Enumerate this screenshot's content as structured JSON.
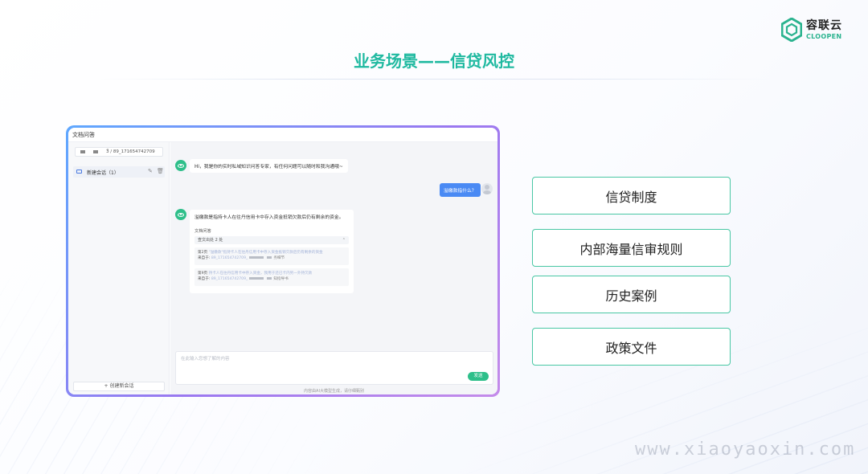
{
  "logo": {
    "name_cn": "容联云",
    "name_en": "CLOOPEN"
  },
  "title": "业务场景——信贷风控",
  "app": {
    "tab_label": "文档问答",
    "sidebar": {
      "kb_select_value": "Ӟ / 89_171654742709",
      "session_label": "新建会话（1）",
      "new_session_label": "+ 创建新会话"
    },
    "chat": {
      "greeting": "Hi，我是你的实时私域知识问答专家，有任何问题可以随时和我沟通哦~",
      "user_question": "溢缴款指什么？",
      "answer": "溢缴款是指持卡人在往丹信用卡中存入资金抵销欠款后仍有剩余的资金。",
      "doc_label": "文档问答",
      "source_header": "查文出处 2 处",
      "sources": [
        {
          "line1_prefix": "第2页",
          "line1_text": "\"溢缴款\"指持卡人在往丹信用卡中存入资金抵销欠款后仍有剩余的资金",
          "line2_prefix": "来自于:",
          "line2_text": "89_171654742709_",
          "line2_suffix": "务细节"
        },
        {
          "line1_prefix": "第9页",
          "line1_text": "持卡人在往丹信用卡中存入资金，我用于还已卡内另一外持欠款",
          "line2_prefix": "来自于:",
          "line2_text": "89_171654742709_",
          "line2_suffix": "知指导书"
        }
      ],
      "input_placeholder": "在此输入您想了解的内容",
      "send_label": "发送",
      "disclaimer": "内容由AI大模型生成，请仔细甄别"
    }
  },
  "features": [
    "信贷制度",
    "内部海量信审规则",
    "历史案例",
    "政策文件"
  ],
  "watermark": "www.xiaoyaoxin.com",
  "colors": {
    "accent": "#2ebf8a",
    "title": "#1fb9a0",
    "card_border": "#49c7a4",
    "user_bubble": "#4a8af4"
  }
}
